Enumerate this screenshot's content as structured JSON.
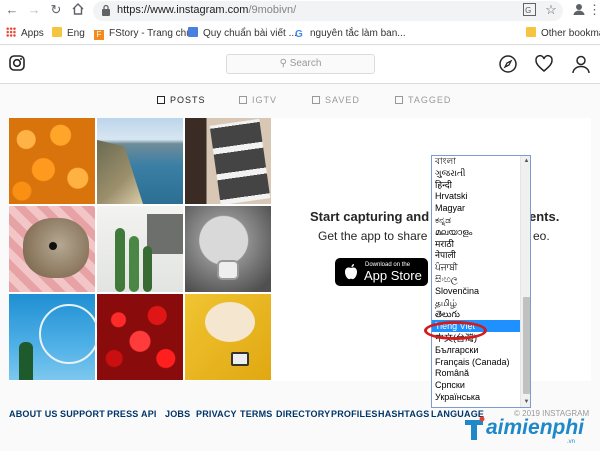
{
  "browser": {
    "url_host": "https://www.instagram.com",
    "url_path": "/9mobivn/",
    "bookmarks": [
      {
        "label": "Apps",
        "icon": "apps-grid-icon"
      },
      {
        "label": "Eng",
        "icon": "folder-icon"
      },
      {
        "label": "FStory - Trang chủ",
        "icon": "fstory-icon"
      },
      {
        "label": "Quy chuẩn bài viết ...",
        "icon": "docs-icon"
      },
      {
        "label": "nguyên tắc làm ban...",
        "icon": "google-icon"
      },
      {
        "label": "Other bookmarks",
        "icon": "folder-icon"
      }
    ]
  },
  "header": {
    "search_placeholder": "Search"
  },
  "tabs": [
    {
      "label": "POSTS",
      "active": true
    },
    {
      "label": "IGTV",
      "active": false
    },
    {
      "label": "SAVED",
      "active": false
    },
    {
      "label": "TAGGED",
      "active": false
    }
  ],
  "promo": {
    "title_start": "Start capturing and sh",
    "title_end": "ents.",
    "subtitle_start": "Get the app to share yo",
    "subtitle_end": "eo.",
    "appstore_small": "Download on the",
    "appstore_big": "App Store"
  },
  "languages": [
    {
      "label": "বাংলা"
    },
    {
      "label": "ગુજરાતી"
    },
    {
      "label": "हिन्दी"
    },
    {
      "label": "Hrvatski"
    },
    {
      "label": "Magyar"
    },
    {
      "label": "ಕನ್ನಡ"
    },
    {
      "label": "മലയാളം"
    },
    {
      "label": "मराठी"
    },
    {
      "label": "नेपाली"
    },
    {
      "label": "ਪੰਜਾਬੀ"
    },
    {
      "label": "සිංහල"
    },
    {
      "label": "Slovenčina"
    },
    {
      "label": "தமிழ்"
    },
    {
      "label": "తెలుగు"
    },
    {
      "label": "Tiếng Việt",
      "selected": true
    },
    {
      "label": "中文(台灣)"
    },
    {
      "label": "Български"
    },
    {
      "label": "Français (Canada)"
    },
    {
      "label": "Română"
    },
    {
      "label": "Српски"
    },
    {
      "label": "Українська"
    }
  ],
  "footer": {
    "links": [
      "ABOUT US",
      "SUPPORT",
      "PRESS",
      "API",
      "JOBS",
      "PRIVACY",
      "TERMS",
      "DIRECTORY",
      "PROFILES",
      "HASHTAGS",
      "LANGUAGE"
    ],
    "copyright": "© 2019 INSTAGRAM"
  },
  "watermark": {
    "text": "aimienphi",
    "sub": ".vn"
  },
  "colors": {
    "accent": "#1e90ff",
    "highlight_ring": "#d21c1c",
    "footer_link": "#003569",
    "watermark": "#1f88c9"
  }
}
